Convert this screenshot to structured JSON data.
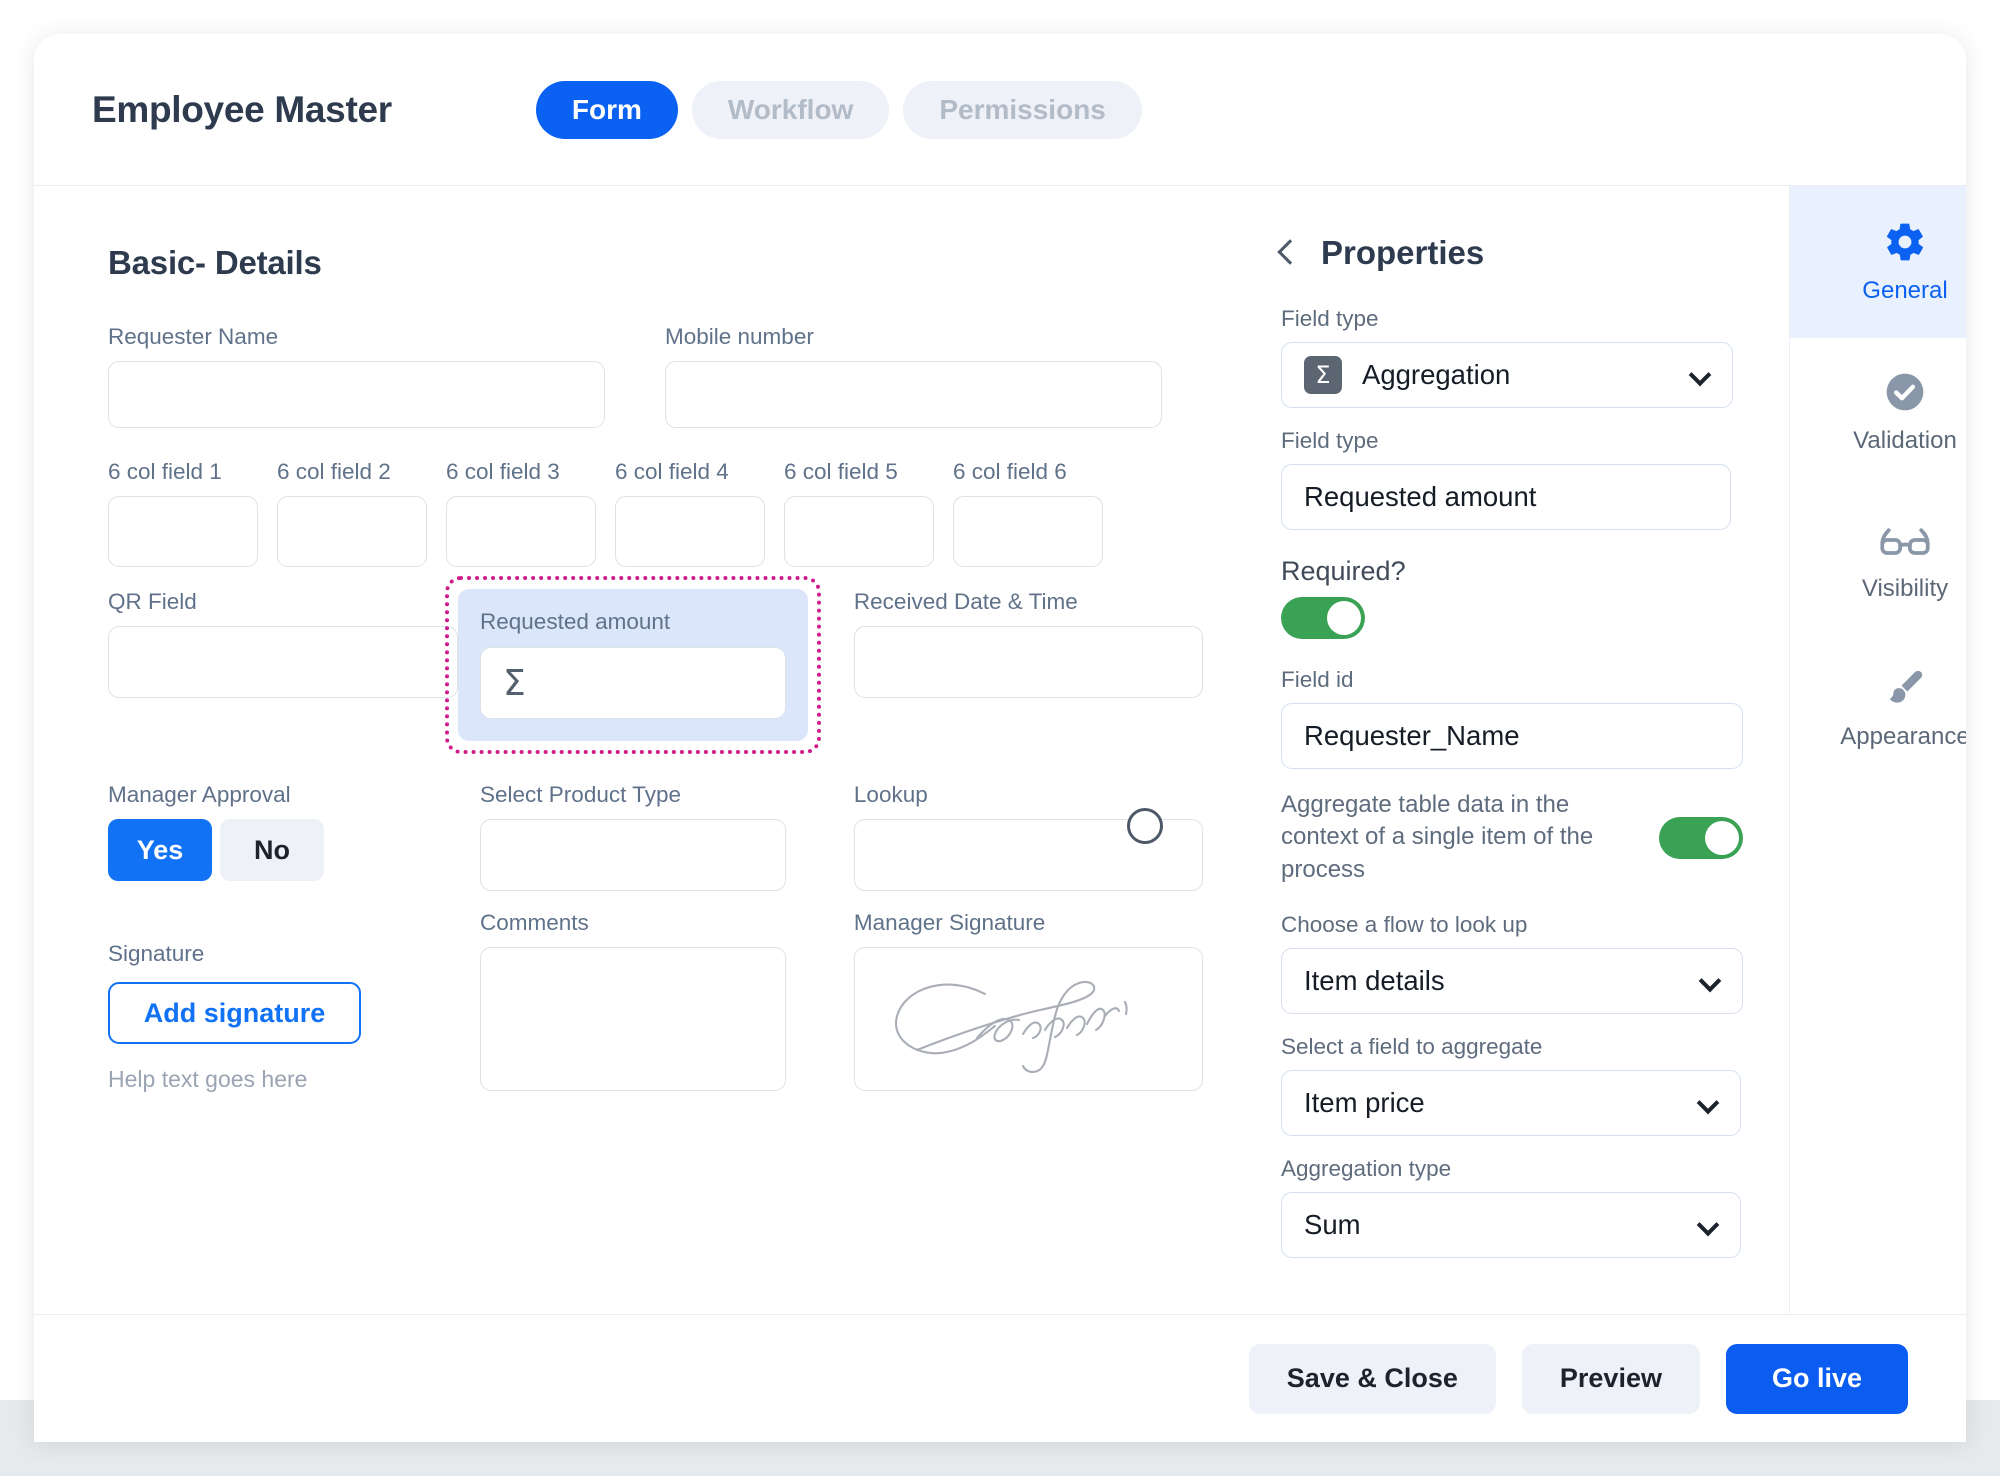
{
  "header": {
    "title": "Employee Master",
    "tabs": [
      {
        "label": "Form",
        "active": true
      },
      {
        "label": "Workflow",
        "active": false
      },
      {
        "label": "Permissions",
        "active": false
      }
    ]
  },
  "form": {
    "section_title": "Basic- Details",
    "row_name": [
      {
        "label": "Requester Name",
        "value": ""
      },
      {
        "label": "Mobile number",
        "value": ""
      }
    ],
    "six_col_fields": [
      {
        "label": "6 col field 1",
        "value": ""
      },
      {
        "label": "6 col field 2",
        "value": ""
      },
      {
        "label": "6 col field 3",
        "value": ""
      },
      {
        "label": "6 col field 4",
        "value": ""
      },
      {
        "label": "6 col field 5",
        "value": ""
      },
      {
        "label": "6 col field 6",
        "value": ""
      }
    ],
    "qr_field": {
      "label": "QR Field",
      "value": ""
    },
    "requested_amount": {
      "label": "Requested amount",
      "icon": "sigma-icon",
      "glyph": "Σ",
      "selected": true
    },
    "received_date": {
      "label": "Received Date & Time",
      "value": ""
    },
    "manager_approval": {
      "label": "Manager Approval",
      "options": [
        {
          "label": "Yes",
          "selected": true
        },
        {
          "label": "No",
          "selected": false
        }
      ]
    },
    "product_type": {
      "label": "Select Product Type",
      "value": ""
    },
    "lookup": {
      "label": "Lookup",
      "value": ""
    },
    "signature": {
      "label": "Signature",
      "button_label": "Add signature",
      "help_text": "Help text goes here"
    },
    "comments": {
      "label": "Comments",
      "value": ""
    },
    "manager_signature": {
      "label": "Manager Signature",
      "has_signature": true
    }
  },
  "properties": {
    "title": "Properties",
    "back_icon": "chevron-left-icon",
    "field_type_label": "Field type",
    "field_type_value": "Aggregation",
    "field_type_icon": "sigma-badge-icon",
    "field_type_glyph": "Σ",
    "field_name_label": "Field type",
    "field_name_value": "Requested amount",
    "required_label": "Required?",
    "required_on": true,
    "field_id_label": "Field id",
    "field_id_value": "Requester_Name",
    "aggregate_context_label": "Aggregate table data in the context of a single item of the process",
    "aggregate_context_on": true,
    "flow_label": "Choose a flow to look up",
    "flow_value": "Item details",
    "agg_field_label": "Select a field to aggregate",
    "agg_field_value": "Item price",
    "agg_type_label": "Aggregation type",
    "agg_type_value": "Sum"
  },
  "rail": [
    {
      "label": "General",
      "icon": "gear-icon",
      "active": true
    },
    {
      "label": "Validation",
      "icon": "check-circle-icon",
      "active": false
    },
    {
      "label": "Visibility",
      "icon": "glasses-icon",
      "active": false
    },
    {
      "label": "Appearance",
      "icon": "paintbrush-icon",
      "active": false
    }
  ],
  "footer": {
    "save_close_label": "Save  & Close",
    "preview_label": "Preview",
    "go_live_label": "Go live"
  },
  "colors": {
    "accent_blue": "#0b62f2",
    "selection_pink": "#d01b8a",
    "selection_fill": "#dbe6fb",
    "toggle_green": "#3aa254"
  }
}
